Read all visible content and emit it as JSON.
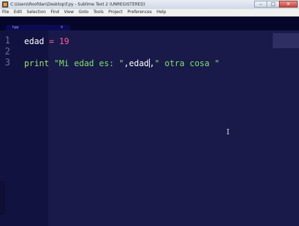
{
  "window": {
    "title": "C:\\Users\\Roofdan\\Desktop\\f.py - Sublime Text 2 (UNREGISTERED)",
    "controls": {
      "minimize": "–",
      "maximize": "□",
      "close": "✕"
    }
  },
  "menu": {
    "items": [
      "File",
      "Edit",
      "Selection",
      "Find",
      "View",
      "Goto",
      "Tools",
      "Project",
      "Preferences",
      "Help"
    ]
  },
  "tabs": [
    {
      "label": "f.py",
      "close": "×",
      "active": true
    }
  ],
  "editor": {
    "line_numbers": [
      "1",
      "2",
      "3"
    ],
    "line1": {
      "var": "edad",
      "op": " = ",
      "num": "19"
    },
    "line3": {
      "kw": "print",
      "space": " ",
      "str1": "\"Mi edad es: \"",
      "sep1": ",",
      "var_before_caret": "edad",
      "sep2": ",",
      "str2": "\" otra cosa \""
    },
    "mouse_cursor": "I"
  },
  "colors": {
    "editor_background": "#1a1a4a",
    "gutter_background": "#121240",
    "keyword": "#9fe36b",
    "string": "#7ce06a",
    "number": "#ff5f9a",
    "operator": "#ff5f9a",
    "line_number": "#6c6c9c"
  }
}
